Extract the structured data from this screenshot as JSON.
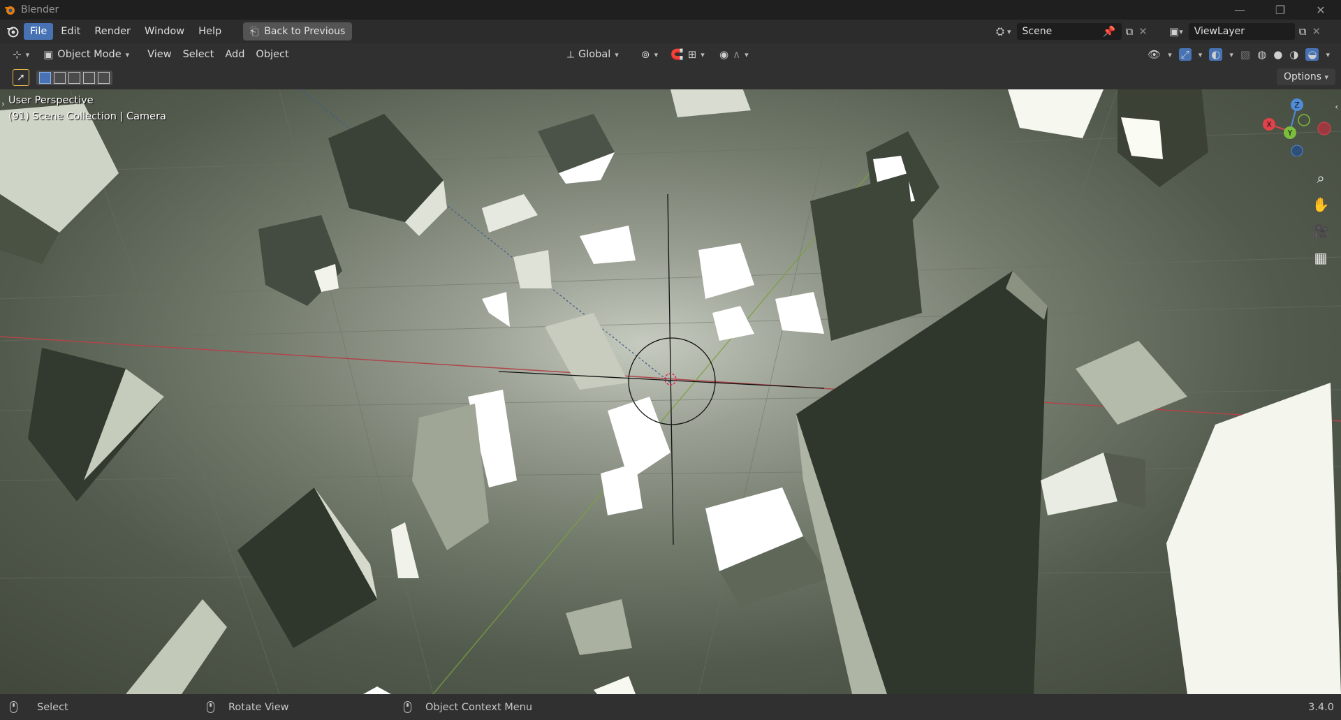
{
  "window": {
    "title": "Blender"
  },
  "menu": {
    "items": [
      "File",
      "Edit",
      "Render",
      "Window",
      "Help"
    ],
    "active": "File",
    "back_button": "Back to Previous"
  },
  "workspace": {
    "scene_name": "Scene",
    "view_layer": "ViewLayer"
  },
  "header": {
    "mode": "Object Mode",
    "menus": [
      "View",
      "Select",
      "Add",
      "Object"
    ],
    "transform_orientation": "Global"
  },
  "toolbar": {
    "options_label": "Options"
  },
  "viewport": {
    "perspective_label": "User Perspective",
    "collection_label": "(91) Scene Collection | Camera",
    "gizmo_axes": {
      "x": "X",
      "y": "Y",
      "z": "Z"
    },
    "colors": {
      "x_axis": "#e0424b",
      "y_axis": "#7bbd3c",
      "z_axis": "#4f8bd6"
    }
  },
  "statusbar": {
    "select": "Select",
    "rotate_view": "Rotate View",
    "context_menu": "Object Context Menu",
    "version": "3.4.0"
  },
  "icons": [
    "blender-logo-icon",
    "editor-type-icon",
    "object-mode-icon",
    "orientation-icon",
    "pivot-icon",
    "snap-icon",
    "proportional-icon",
    "visibility-icon",
    "gizmo-icon",
    "overlay-icon",
    "xray-icon",
    "shading-wireframe-icon",
    "shading-solid-icon",
    "shading-material-icon",
    "shading-rendered-icon",
    "zoom-icon",
    "hand-icon",
    "camera-icon",
    "grid-icon",
    "mouse-left-icon",
    "mouse-middle-icon",
    "mouse-right-icon"
  ]
}
